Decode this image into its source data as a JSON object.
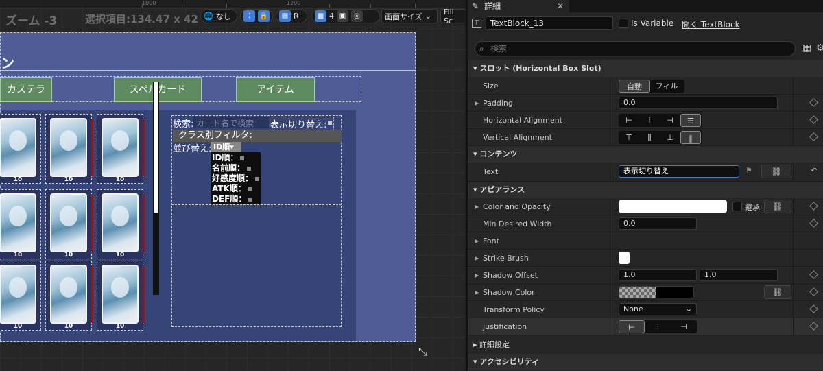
{
  "toolbar": {
    "zoom": "ズーム -3",
    "selection": "選択項目:134.47 x 42",
    "world_label": "なし",
    "r_label": "R",
    "grid_value": "4",
    "screen_size": "画面サイズ",
    "fill_label": "Fill Sc"
  },
  "ruler": {
    "mark_1000": "1000",
    "mark_1200": "1200"
  },
  "canvas": {
    "title_fragment": "ン",
    "tabs": [
      "カステラ",
      "スペルカード",
      "アイテム"
    ],
    "card_numbers": [
      "10",
      "10",
      "10",
      "10",
      "10",
      "10",
      "10",
      "10",
      "10"
    ],
    "search_label": "検索:",
    "search_placeholder": "カード名で検索",
    "toggle_label": "表示切り替え:",
    "class_filter": "クラス別フィルタ:",
    "sort_label": "並び替え:",
    "sort_selected": "ID順▾",
    "sort_options": [
      "ID順：",
      "名前順：",
      "好感度順：",
      "ATK順：",
      "DEF順："
    ]
  },
  "details": {
    "tab_title": "詳細",
    "widget_name": "TextBlock_13",
    "is_variable": "Is Variable",
    "open_link": "開く TextBlock",
    "search_placeholder": "検索",
    "sections": {
      "slot": "スロット (Horizontal Box Slot)",
      "content": "コンテンツ",
      "appearance": "アピアランス",
      "advanced": "詳細設定",
      "accessibility": "アクセシビリティ"
    },
    "size": {
      "label": "Size",
      "auto": "自動",
      "fill": "フィル"
    },
    "padding": {
      "label": "Padding",
      "value": "0.0"
    },
    "h_align": {
      "label": "Horizontal Alignment"
    },
    "v_align": {
      "label": "Vertical Alignment"
    },
    "text": {
      "label": "Text",
      "value": "表示切り替え"
    },
    "color_opacity": {
      "label": "Color and Opacity",
      "inherit": "継承"
    },
    "min_width": {
      "label": "Min Desired Width",
      "value": "0.0"
    },
    "font": {
      "label": "Font"
    },
    "strike": {
      "label": "Strike Brush"
    },
    "shadow_offset": {
      "label": "Shadow Offset",
      "x": "1.0",
      "y": "1.0"
    },
    "shadow_color": {
      "label": "Shadow Color"
    },
    "transform": {
      "label": "Transform Policy",
      "value": "None"
    },
    "justification": {
      "label": "Justification"
    }
  },
  "colors": {
    "accent": "#3d7dd8",
    "canvas_bg": "#4e5d96",
    "tab_green": "#5d8a5e"
  }
}
